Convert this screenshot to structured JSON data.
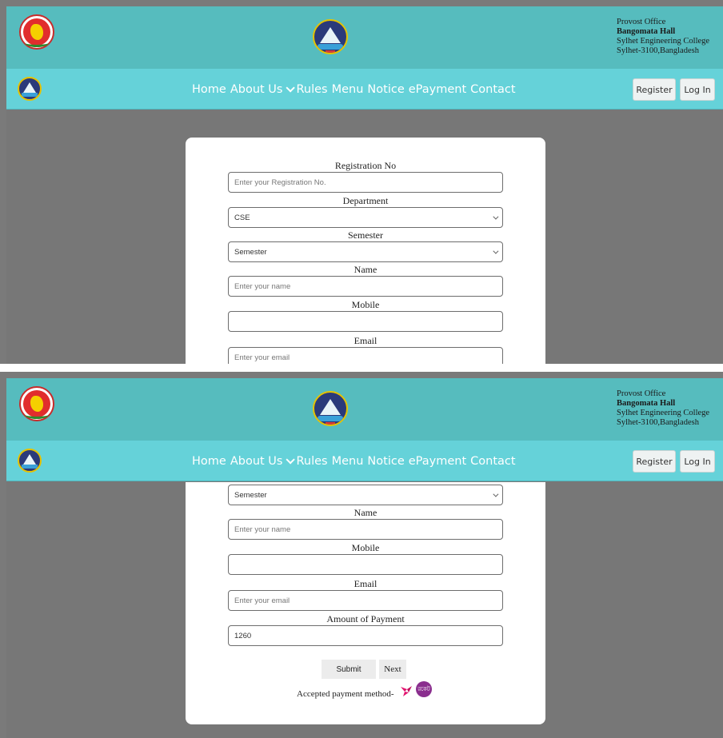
{
  "header": {
    "office": "Provost Office",
    "hall": "Bangomata Hall",
    "college": "Sylhet Engineering College",
    "address": "Sylhet-3100,Bangladesh"
  },
  "nav": {
    "home": "Home",
    "about": "About Us",
    "rules": "Rules",
    "menu": "Menu",
    "notice": "Notice",
    "epayment": "ePayment",
    "contact": "Contact",
    "register": "Register",
    "login": "Log In"
  },
  "form": {
    "registration_label": "Registration No",
    "registration_placeholder": "Enter your Registration No.",
    "department_label": "Department",
    "department_value": "CSE",
    "semester_label": "Semester",
    "semester_value": "Semester",
    "name_label": "Name",
    "name_placeholder": "Enter your name",
    "mobile_label": "Mobile",
    "email_label": "Email",
    "email_placeholder": "Enter your email",
    "amount_label": "Amount of Payment",
    "amount_value": "1260",
    "submit": "Submit",
    "next": "Next",
    "accepted": "Accepted payment method-",
    "rocket": "রকেট"
  },
  "colors": {
    "header_bg": "#56bcbe",
    "nav_bg": "#65d2d9",
    "page_bg": "#777777",
    "bkash": "#e2136e",
    "rocket": "#8a2e8e"
  },
  "icons": {
    "gov_emblem": "bangladesh-govt-emblem",
    "college_logo": "college-logo",
    "payment_1": "bkash-bird",
    "payment_2": "rocket-logo"
  }
}
